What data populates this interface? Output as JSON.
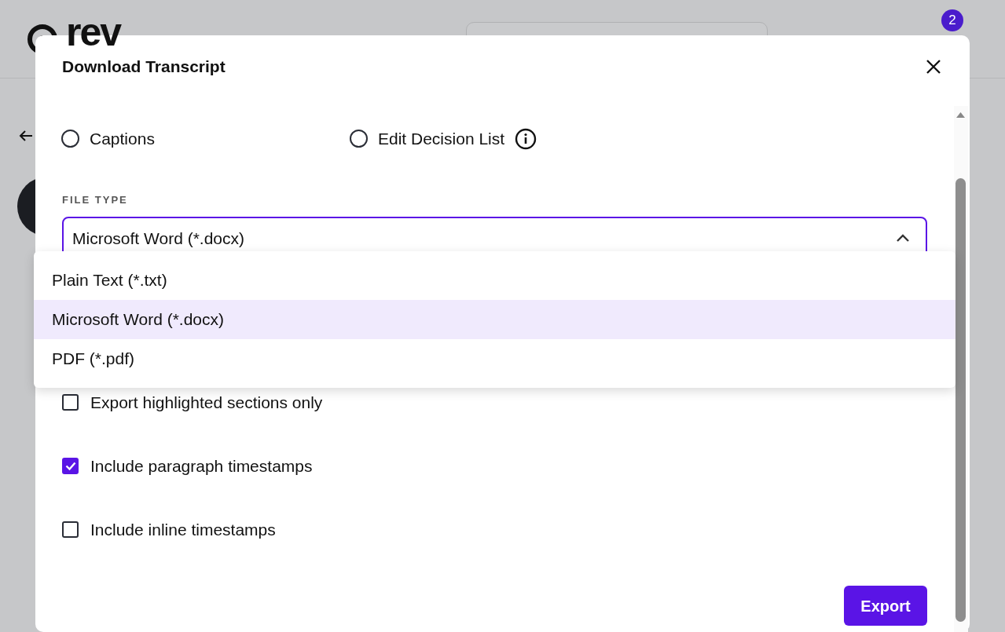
{
  "app_header": {
    "logo_text": "rev",
    "notification_count": "2"
  },
  "dialog": {
    "title": "Download Transcript",
    "format_options": [
      {
        "label": "Captions",
        "selected": false,
        "info": false
      },
      {
        "label": "Edit Decision List",
        "selected": false,
        "info": true
      }
    ],
    "file_type": {
      "label": "FILE TYPE",
      "value": "Microsoft Word (*.docx)",
      "expanded": true,
      "options": [
        {
          "label": "Plain Text (*.txt)",
          "selected": false
        },
        {
          "label": "Microsoft Word (*.docx)",
          "selected": true
        },
        {
          "label": "PDF (*.pdf)",
          "selected": false
        }
      ]
    },
    "options": [
      {
        "label": "Export highlighted sections only",
        "checked": false
      },
      {
        "label": "Include paragraph timestamps",
        "checked": true
      },
      {
        "label": "Include inline timestamps",
        "checked": false
      }
    ],
    "export_button": "Export"
  }
}
